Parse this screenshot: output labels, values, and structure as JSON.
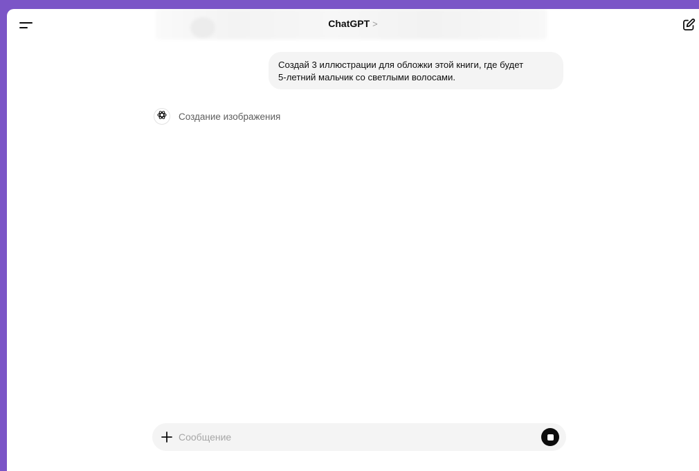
{
  "header": {
    "title": "ChatGPT",
    "title_chevron": ">"
  },
  "icons": {
    "menu": "menu-icon",
    "compose": "new-chat-icon",
    "assistant": "openai-logo-icon",
    "plus": "plus-icon",
    "stop": "stop-icon"
  },
  "conversation": {
    "user_message": {
      "line1": "Создай 3 иллюстрации для обложки этой книги, где будет",
      "line2": "5-летний мальчик со светлыми волосами."
    },
    "assistant_status": "Создание изображения"
  },
  "composer": {
    "placeholder": "Сообщение",
    "value": ""
  },
  "colors": {
    "frame_background": "#7b55c7",
    "bubble_background": "#f4f4f4",
    "composer_background": "#f4f4f4",
    "stop_button": "#0d0d0d"
  }
}
